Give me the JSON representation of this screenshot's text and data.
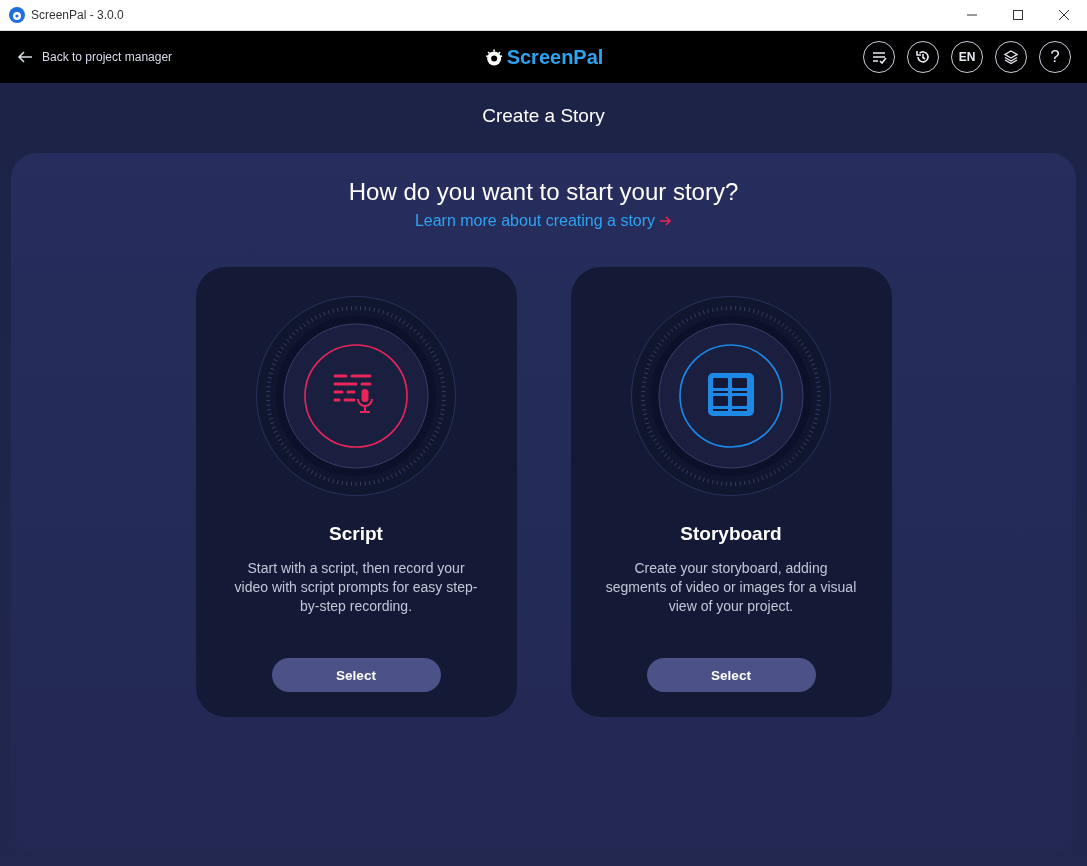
{
  "window": {
    "title": "ScreenPal - 3.0.0"
  },
  "header": {
    "back_label": "Back to project manager",
    "logo": "ScreenPal",
    "buttons": [
      {
        "kind": "checklist"
      },
      {
        "kind": "history"
      },
      {
        "kind": "text",
        "label": "EN"
      },
      {
        "kind": "layers"
      },
      {
        "kind": "text",
        "label": "?"
      }
    ]
  },
  "page_title": "Create a Story",
  "panel": {
    "heading": "How do you want to start your story?",
    "link": "Learn more about creating a story",
    "cards": [
      {
        "kind": "script",
        "color": "#e8265a",
        "title": "Script",
        "description": "Start with a script, then record your video with script prompts for easy step-by-step recording.",
        "button": "Select"
      },
      {
        "kind": "storyboard",
        "color": "#1e88e5",
        "title": "Storyboard",
        "description": "Create your storyboard, adding segments of video or images for a visual view of your project.",
        "button": "Select"
      }
    ]
  }
}
